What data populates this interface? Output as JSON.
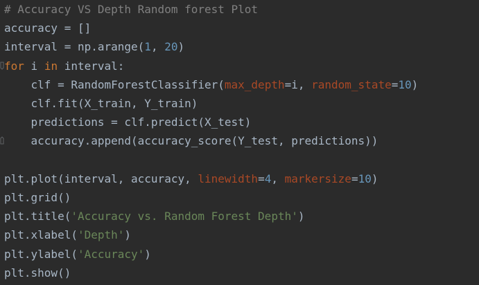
{
  "editor": {
    "lines": [
      {
        "tokens": [
          {
            "type": "comment",
            "text": "# Accuracy VS Depth Random forest Plot"
          }
        ]
      },
      {
        "tokens": [
          {
            "type": "plain",
            "text": "accuracy = []"
          }
        ]
      },
      {
        "tokens": [
          {
            "type": "plain",
            "text": "interval = np.arange("
          },
          {
            "type": "num",
            "text": "1"
          },
          {
            "type": "plain",
            "text": ", "
          },
          {
            "type": "num",
            "text": "20"
          },
          {
            "type": "plain",
            "text": ")"
          }
        ]
      },
      {
        "tokens": [
          {
            "type": "kw",
            "text": "for"
          },
          {
            "type": "plain",
            "text": " i "
          },
          {
            "type": "kw",
            "text": "in"
          },
          {
            "type": "plain",
            "text": " interval:"
          }
        ]
      },
      {
        "tokens": [
          {
            "type": "plain",
            "text": "    clf = RandomForestClassifier("
          },
          {
            "type": "param",
            "text": "max_depth"
          },
          {
            "type": "plain",
            "text": "=i, "
          },
          {
            "type": "param",
            "text": "random_state"
          },
          {
            "type": "plain",
            "text": "="
          },
          {
            "type": "num",
            "text": "10"
          },
          {
            "type": "plain",
            "text": ")"
          }
        ]
      },
      {
        "tokens": [
          {
            "type": "plain",
            "text": "    clf.fit(X_train, Y_train)"
          }
        ]
      },
      {
        "tokens": [
          {
            "type": "plain",
            "text": "    predictions = clf.predict(X_test)"
          }
        ]
      },
      {
        "tokens": [
          {
            "type": "plain",
            "text": "    accuracy.append(accuracy_score(Y_test, predictions))"
          }
        ]
      },
      {
        "tokens": [
          {
            "type": "plain",
            "text": ""
          }
        ]
      },
      {
        "tokens": [
          {
            "type": "plain",
            "text": "plt.plot(interval, accuracy, "
          },
          {
            "type": "param",
            "text": "linewidth"
          },
          {
            "type": "plain",
            "text": "="
          },
          {
            "type": "num",
            "text": "4"
          },
          {
            "type": "plain",
            "text": ", "
          },
          {
            "type": "param",
            "text": "markersize"
          },
          {
            "type": "plain",
            "text": "="
          },
          {
            "type": "num",
            "text": "10"
          },
          {
            "type": "plain",
            "text": ")"
          }
        ]
      },
      {
        "tokens": [
          {
            "type": "plain",
            "text": "plt.grid()"
          }
        ]
      },
      {
        "tokens": [
          {
            "type": "plain",
            "text": "plt.title("
          },
          {
            "type": "str",
            "text": "'Accuracy vs. Random Forest Depth'"
          },
          {
            "type": "plain",
            "text": ")"
          }
        ]
      },
      {
        "tokens": [
          {
            "type": "plain",
            "text": "plt.xlabel("
          },
          {
            "type": "str",
            "text": "'Depth'"
          },
          {
            "type": "plain",
            "text": ")"
          }
        ]
      },
      {
        "tokens": [
          {
            "type": "plain",
            "text": "plt.ylabel("
          },
          {
            "type": "str",
            "text": "'Accuracy'"
          },
          {
            "type": "plain",
            "text": ")"
          }
        ]
      },
      {
        "tokens": [
          {
            "type": "plain",
            "text": "plt.show()"
          }
        ]
      }
    ]
  }
}
